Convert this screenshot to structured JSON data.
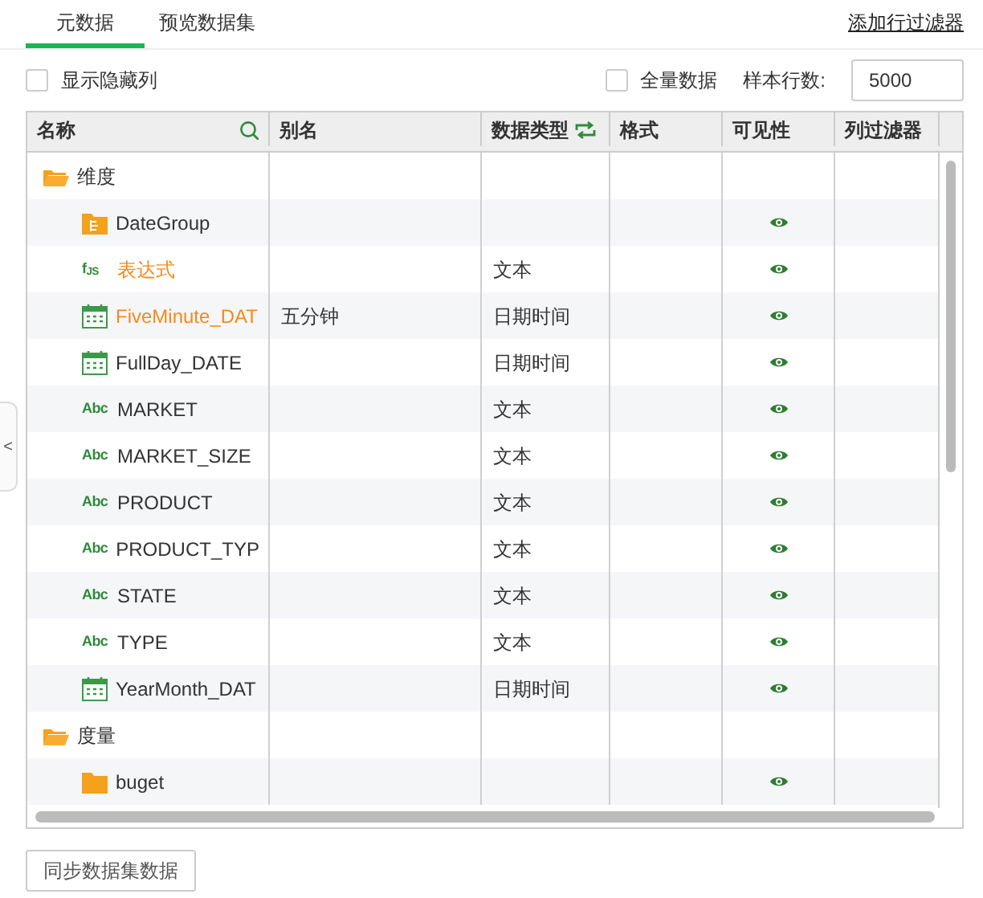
{
  "tabs": [
    {
      "label": "元数据",
      "selected": true
    },
    {
      "label": "预览数据集",
      "selected": false
    }
  ],
  "add_filter_link": "添加行过滤器",
  "options": {
    "show_hidden": {
      "label": "显示隐藏列",
      "checked": false
    },
    "full_data": {
      "label": "全量数据",
      "checked": false
    },
    "sample_rows": {
      "label": "样本行数:",
      "value": "5000"
    }
  },
  "table": {
    "columns": [
      "名称",
      "别名",
      "数据类型",
      "格式",
      "可见性",
      "列过滤器"
    ],
    "rows": [
      {
        "name": "维度",
        "kind": "folder",
        "children": [
          {
            "name": "DateGroup",
            "kind": "group",
            "visible": true,
            "highlighted": false
          },
          {
            "name": "表达式",
            "kind": "expression",
            "badge": "f$_{JS}$",
            "type": "文本",
            "visible": true,
            "highlighted": true
          },
          {
            "name": "FiveMinute_DAT",
            "kind": "date",
            "alias": "五分钟",
            "type": "日期时间",
            "visible": true,
            "highlighted": true
          },
          {
            "name": "FullDay_DATE",
            "kind": "date",
            "type": "日期时间",
            "visible": true,
            "highlighted": false
          },
          {
            "name": "MARKET",
            "kind": "text",
            "badge": "Abc",
            "type": "文本",
            "visible": true,
            "highlighted": false
          },
          {
            "name": "MARKET_SIZE",
            "kind": "text",
            "badge": "Abc",
            "type": "文本",
            "visible": true,
            "highlighted": false
          },
          {
            "name": "PRODUCT",
            "kind": "text",
            "badge": "Abc",
            "type": "文本",
            "visible": true,
            "highlighted": false
          },
          {
            "name": "PRODUCT_TYP",
            "kind": "text",
            "badge": "Abc",
            "type": "文本",
            "visible": true,
            "highlighted": false
          },
          {
            "name": "STATE",
            "kind": "text",
            "badge": "Abc",
            "type": "文本",
            "visible": true,
            "highlighted": false
          },
          {
            "name": "TYPE",
            "kind": "text",
            "badge": "Abc",
            "type": "文本",
            "visible": true,
            "highlighted": false
          },
          {
            "name": "YearMonth_DAT",
            "kind": "date",
            "type": "日期时间",
            "visible": true,
            "highlighted": false
          }
        ]
      },
      {
        "name": "度量",
        "kind": "folder",
        "children": [
          {
            "name": "buget",
            "kind": "closed-folder",
            "visible": true,
            "highlighted": false
          }
        ]
      }
    ]
  },
  "collapse_handle": "<",
  "sync_button": "同步数据集数据"
}
